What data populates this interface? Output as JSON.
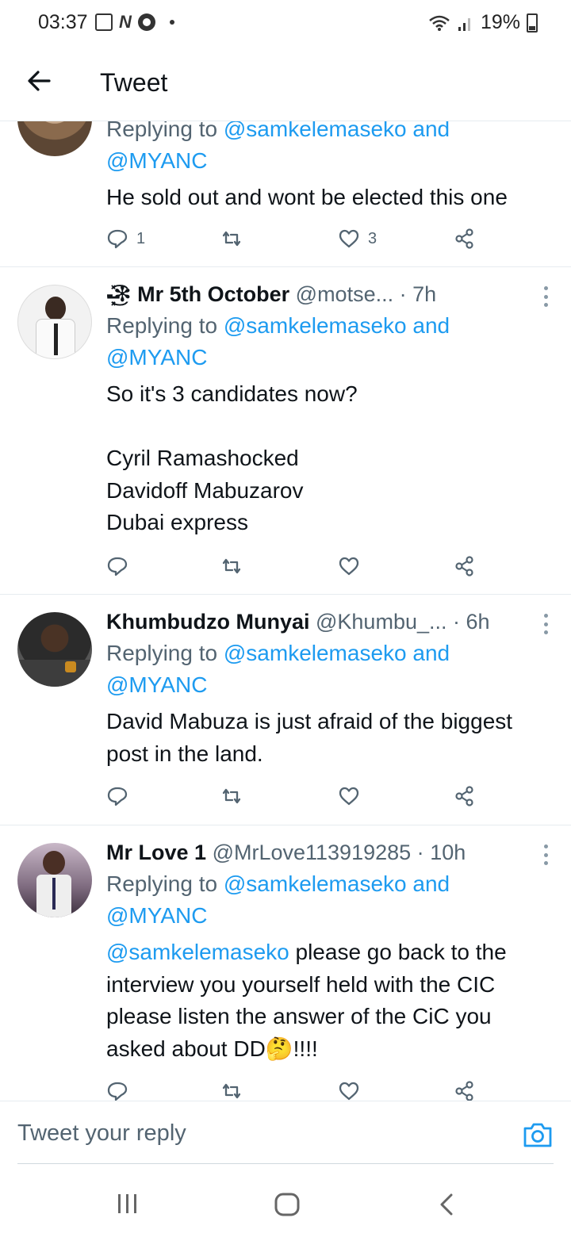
{
  "status_bar": {
    "time": "03:37",
    "battery": "19%"
  },
  "header": {
    "title": "Tweet"
  },
  "tweets": [
    {
      "replying_label": "Replying to",
      "replying_to": [
        "@samkelemaseko",
        "@MYANC"
      ],
      "and_word": "and",
      "text": "He sold out and wont be elected this one",
      "reply_count": "1",
      "like_count": "3"
    },
    {
      "name": "-̶͓̽͜͡✻ Mr 5th October",
      "handle": "@motse...",
      "time": "7h",
      "replying_label": "Replying to",
      "replying_to": [
        "@samkelemaseko",
        "@MYANC"
      ],
      "and_word": "and",
      "text": "So it's 3 candidates now?\n\nCyril Ramashocked\nDavidoff Mabuzarov\nDubai express"
    },
    {
      "name": "Khumbudzo Munyai",
      "handle": "@Khumbu_...",
      "time": "6h",
      "replying_label": "Replying to",
      "replying_to": [
        "@samkelemaseko",
        "@MYANC"
      ],
      "and_word": "and",
      "text": "David Mabuza is just afraid of the biggest post in the land."
    },
    {
      "name": "Mr Love 1",
      "handle": "@MrLove113919285",
      "time": "10h",
      "replying_label": "Replying to",
      "replying_to": [
        "@samkelemaseko",
        "@MYANC"
      ],
      "and_word": "and",
      "text_mention": "@samkelemaseko",
      "text": " please go back to the interview you yourself held with the CIC please listen the answer of the CiC you asked about DD🤔!!!!"
    }
  ],
  "reply_bar": {
    "placeholder": "Tweet your reply"
  },
  "colors": {
    "link": "#1d9bf0",
    "muted": "#536471",
    "divider": "#e6ecf0"
  },
  "icons": [
    "back-arrow-icon",
    "reply-icon",
    "retweet-icon",
    "like-icon",
    "share-icon",
    "camera-icon",
    "more-icon"
  ]
}
